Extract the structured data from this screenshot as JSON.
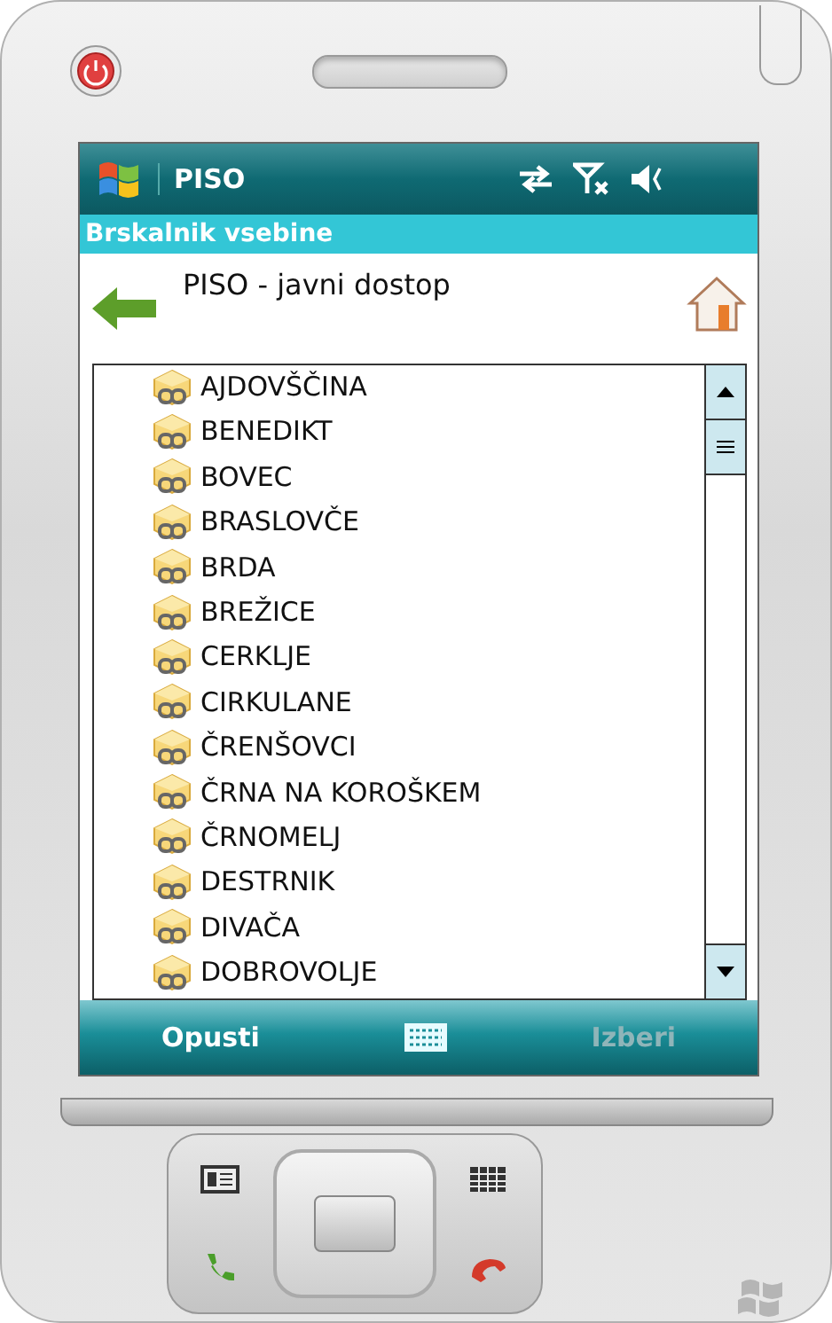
{
  "title_bar": {
    "title": "PISO"
  },
  "header": {
    "title": "Brskalnik vsebine"
  },
  "location": {
    "path": "PISO - javni dostop"
  },
  "list": {
    "items": [
      {
        "label": "AJDOVŠČINA"
      },
      {
        "label": "BENEDIKT"
      },
      {
        "label": "BOVEC"
      },
      {
        "label": "BRASLOVČE"
      },
      {
        "label": "BRDA"
      },
      {
        "label": "BREŽICE"
      },
      {
        "label": "CERKLJE"
      },
      {
        "label": "CIRKULANE"
      },
      {
        "label": "ČRENŠOVCI"
      },
      {
        "label": "ČRNA NA KOROŠKEM"
      },
      {
        "label": "ČRNOMELJ"
      },
      {
        "label": "DESTRNIK"
      },
      {
        "label": "DIVAČA"
      },
      {
        "label": "DOBROVOLJE"
      }
    ]
  },
  "softkeys": [
    {
      "label": "Opusti",
      "disabled": false
    },
    {
      "label": "Izberi",
      "disabled": true
    }
  ]
}
